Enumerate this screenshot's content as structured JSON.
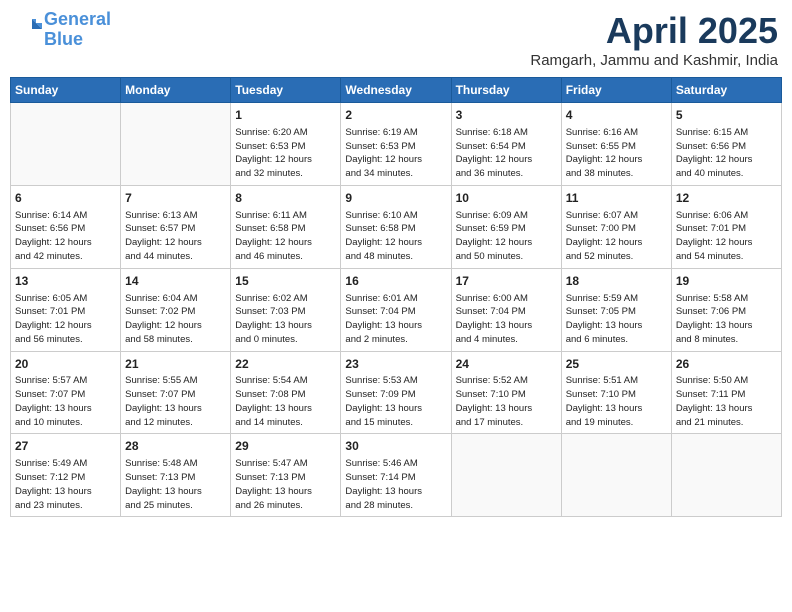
{
  "header": {
    "logo_general": "General",
    "logo_blue": "Blue",
    "month_title": "April 2025",
    "subtitle": "Ramgarh, Jammu and Kashmir, India"
  },
  "days_of_week": [
    "Sunday",
    "Monday",
    "Tuesday",
    "Wednesday",
    "Thursday",
    "Friday",
    "Saturday"
  ],
  "weeks": [
    [
      {
        "day": "",
        "info": ""
      },
      {
        "day": "",
        "info": ""
      },
      {
        "day": "1",
        "info": "Sunrise: 6:20 AM\nSunset: 6:53 PM\nDaylight: 12 hours\nand 32 minutes."
      },
      {
        "day": "2",
        "info": "Sunrise: 6:19 AM\nSunset: 6:53 PM\nDaylight: 12 hours\nand 34 minutes."
      },
      {
        "day": "3",
        "info": "Sunrise: 6:18 AM\nSunset: 6:54 PM\nDaylight: 12 hours\nand 36 minutes."
      },
      {
        "day": "4",
        "info": "Sunrise: 6:16 AM\nSunset: 6:55 PM\nDaylight: 12 hours\nand 38 minutes."
      },
      {
        "day": "5",
        "info": "Sunrise: 6:15 AM\nSunset: 6:56 PM\nDaylight: 12 hours\nand 40 minutes."
      }
    ],
    [
      {
        "day": "6",
        "info": "Sunrise: 6:14 AM\nSunset: 6:56 PM\nDaylight: 12 hours\nand 42 minutes."
      },
      {
        "day": "7",
        "info": "Sunrise: 6:13 AM\nSunset: 6:57 PM\nDaylight: 12 hours\nand 44 minutes."
      },
      {
        "day": "8",
        "info": "Sunrise: 6:11 AM\nSunset: 6:58 PM\nDaylight: 12 hours\nand 46 minutes."
      },
      {
        "day": "9",
        "info": "Sunrise: 6:10 AM\nSunset: 6:58 PM\nDaylight: 12 hours\nand 48 minutes."
      },
      {
        "day": "10",
        "info": "Sunrise: 6:09 AM\nSunset: 6:59 PM\nDaylight: 12 hours\nand 50 minutes."
      },
      {
        "day": "11",
        "info": "Sunrise: 6:07 AM\nSunset: 7:00 PM\nDaylight: 12 hours\nand 52 minutes."
      },
      {
        "day": "12",
        "info": "Sunrise: 6:06 AM\nSunset: 7:01 PM\nDaylight: 12 hours\nand 54 minutes."
      }
    ],
    [
      {
        "day": "13",
        "info": "Sunrise: 6:05 AM\nSunset: 7:01 PM\nDaylight: 12 hours\nand 56 minutes."
      },
      {
        "day": "14",
        "info": "Sunrise: 6:04 AM\nSunset: 7:02 PM\nDaylight: 12 hours\nand 58 minutes."
      },
      {
        "day": "15",
        "info": "Sunrise: 6:02 AM\nSunset: 7:03 PM\nDaylight: 13 hours\nand 0 minutes."
      },
      {
        "day": "16",
        "info": "Sunrise: 6:01 AM\nSunset: 7:04 PM\nDaylight: 13 hours\nand 2 minutes."
      },
      {
        "day": "17",
        "info": "Sunrise: 6:00 AM\nSunset: 7:04 PM\nDaylight: 13 hours\nand 4 minutes."
      },
      {
        "day": "18",
        "info": "Sunrise: 5:59 AM\nSunset: 7:05 PM\nDaylight: 13 hours\nand 6 minutes."
      },
      {
        "day": "19",
        "info": "Sunrise: 5:58 AM\nSunset: 7:06 PM\nDaylight: 13 hours\nand 8 minutes."
      }
    ],
    [
      {
        "day": "20",
        "info": "Sunrise: 5:57 AM\nSunset: 7:07 PM\nDaylight: 13 hours\nand 10 minutes."
      },
      {
        "day": "21",
        "info": "Sunrise: 5:55 AM\nSunset: 7:07 PM\nDaylight: 13 hours\nand 12 minutes."
      },
      {
        "day": "22",
        "info": "Sunrise: 5:54 AM\nSunset: 7:08 PM\nDaylight: 13 hours\nand 14 minutes."
      },
      {
        "day": "23",
        "info": "Sunrise: 5:53 AM\nSunset: 7:09 PM\nDaylight: 13 hours\nand 15 minutes."
      },
      {
        "day": "24",
        "info": "Sunrise: 5:52 AM\nSunset: 7:10 PM\nDaylight: 13 hours\nand 17 minutes."
      },
      {
        "day": "25",
        "info": "Sunrise: 5:51 AM\nSunset: 7:10 PM\nDaylight: 13 hours\nand 19 minutes."
      },
      {
        "day": "26",
        "info": "Sunrise: 5:50 AM\nSunset: 7:11 PM\nDaylight: 13 hours\nand 21 minutes."
      }
    ],
    [
      {
        "day": "27",
        "info": "Sunrise: 5:49 AM\nSunset: 7:12 PM\nDaylight: 13 hours\nand 23 minutes."
      },
      {
        "day": "28",
        "info": "Sunrise: 5:48 AM\nSunset: 7:13 PM\nDaylight: 13 hours\nand 25 minutes."
      },
      {
        "day": "29",
        "info": "Sunrise: 5:47 AM\nSunset: 7:13 PM\nDaylight: 13 hours\nand 26 minutes."
      },
      {
        "day": "30",
        "info": "Sunrise: 5:46 AM\nSunset: 7:14 PM\nDaylight: 13 hours\nand 28 minutes."
      },
      {
        "day": "",
        "info": ""
      },
      {
        "day": "",
        "info": ""
      },
      {
        "day": "",
        "info": ""
      }
    ]
  ]
}
